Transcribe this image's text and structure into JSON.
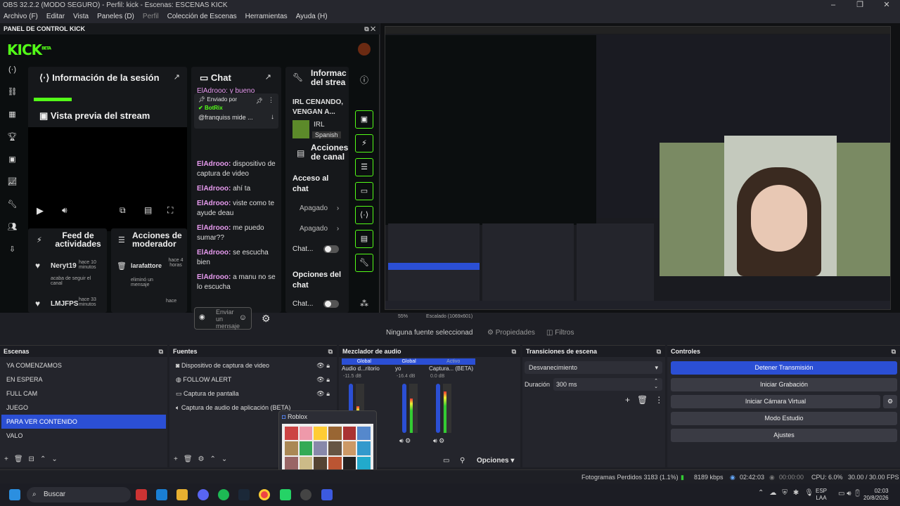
{
  "window": {
    "title": "OBS 32.2.2 (MODO SEGURO) - Perfil: kick - Escenas: ESCENAS KICK",
    "controls": [
      "–",
      "❐",
      "✕"
    ]
  },
  "menu": [
    {
      "label": "Archivo (F)"
    },
    {
      "label": "Editar"
    },
    {
      "label": "Vista"
    },
    {
      "label": "Paneles (D)"
    },
    {
      "label": "Perfil",
      "dim": true
    },
    {
      "label": "Colección de Escenas"
    },
    {
      "label": "Herramientas"
    },
    {
      "label": "Ayuda (H)"
    }
  ],
  "kick": {
    "panel_title": "PANEL DE CONTROL KICK",
    "logo": "KICK",
    "logo_badge": "BETA",
    "session_title": "Información de la sesión",
    "preview_title": "Vista previa del stream",
    "chat_title": "Chat",
    "pinned": {
      "label": "Enviado por",
      "bot": "BotRix",
      "text": "@franquiss mide ..."
    },
    "chat_partial": "ElAdrooo: y bueno",
    "messages": [
      {
        "user": "ElAdrooo:",
        "text": "dispositivo de captura de video"
      },
      {
        "user": "ElAdrooo:",
        "text": "ahí ta"
      },
      {
        "user": "ElAdrooo:",
        "text": "viste como te ayude deau"
      },
      {
        "user": "ElAdrooo:",
        "text": "me puedo sumar??"
      },
      {
        "user": "ElAdrooo:",
        "text": "se escucha bien"
      },
      {
        "user": "ElAdrooo:",
        "text": "a manu no se lo escucha"
      }
    ],
    "send_placeholder": "Enviar un mensaje",
    "info_title": "Informac del strea",
    "stream_title": "IRL CENANDO, VENGAN A...",
    "category": "IRL",
    "language": "Spanish",
    "mod_actions_title": "Acciones de canal",
    "chat_access": "Acceso al chat",
    "off1": "Apagado",
    "off2": "Apagado",
    "chat_toggle": "Chat...",
    "chat_options": "Opciones del chat",
    "chat_toggle2": "Chat...",
    "feed_title": "Feed de actividades",
    "moderator_title": "Acciones de moderador",
    "feed": [
      {
        "user": "Neryt19",
        "time": "hace 10 minutos",
        "desc": "acaba de seguir el canal"
      },
      {
        "user": "LMJFPS",
        "time": "hace 33 minutos"
      }
    ],
    "mod": [
      {
        "user": "larafattore",
        "time": "hace 4 horas",
        "desc": "eliminó un mensaje"
      },
      {
        "time": "hace"
      }
    ]
  },
  "preview": {
    "no_source": "Ninguna fuente seleccionad",
    "properties": "Propiedades",
    "filters": "Filtros",
    "zoom": "55%",
    "scaling": "Escalado (1069x601)"
  },
  "scenes": {
    "title": "Escenas",
    "items": [
      "YA COMENZAMOS",
      "EN ESPERA",
      "FULL CAM",
      "JUEGO",
      "PARA VER CONTENIDO",
      "VALO"
    ],
    "selected": 4
  },
  "sources": {
    "title": "Fuentes",
    "items": [
      "Dispositivo de captura de video",
      "FOLLOW ALERT",
      "Captura de pantalla",
      "Captura de audio de aplicación (BETA)"
    ]
  },
  "mixer": {
    "title": "Mezclador de audio",
    "tags": [
      "Global",
      "Global",
      "Activo"
    ],
    "channels": [
      {
        "name": "Audio d...ritorio",
        "db": "-11.5 dB",
        "level": 0.55
      },
      {
        "name": "yo",
        "db": "-16.4 dB",
        "level": 0.7
      },
      {
        "name": "Captura... (BETA)",
        "db": "0.0 dB",
        "level": 0.85
      }
    ],
    "options": "Opciones"
  },
  "transitions": {
    "title": "Transiciones de escena",
    "type": "Desvanecimiento",
    "duration_label": "Duración",
    "duration": "300 ms"
  },
  "controls": {
    "title": "Controles",
    "buttons": [
      "Detener Transmisión",
      "Iniciar Grabación",
      "Iniciar Cámara Virtual",
      "Modo Estudio",
      "Ajustes"
    ]
  },
  "status": {
    "dropped": "Fotogramas Perdidos 3183 (1.1%)",
    "bitrate": "8189 kbps",
    "live": "02:42:03",
    "rec": "00:00:00",
    "cpu": "CPU: 6.0%",
    "fps": "30.00 / 30.00 FPS"
  },
  "popup": {
    "title": "Roblox"
  },
  "taskbar": {
    "search": "Buscar",
    "lang": "ESP",
    "region": "LAA",
    "time": "02:03",
    "date": "20/8/2026"
  },
  "colors": {
    "kick_green": "#53fc18",
    "accent_blue": "#2b4fd4"
  }
}
